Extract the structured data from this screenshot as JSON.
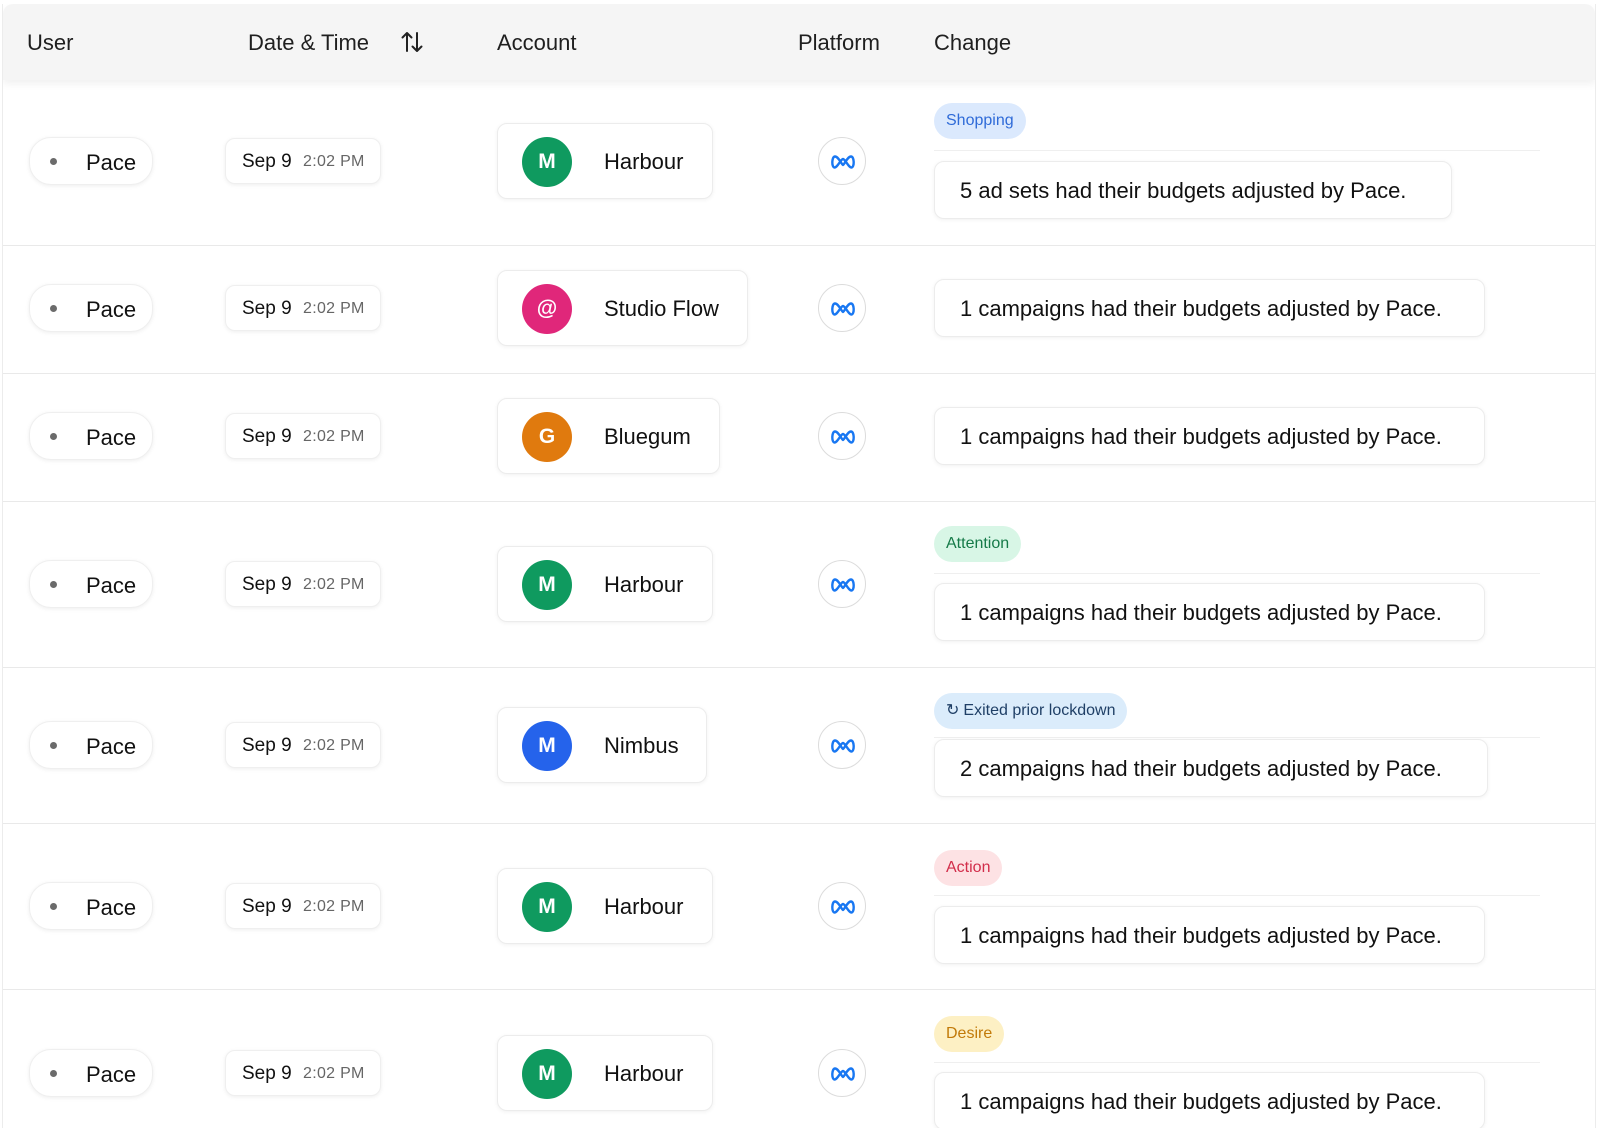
{
  "header": {
    "user": "User",
    "date_time": "Date & Time",
    "account": "Account",
    "platform": "Platform",
    "change": "Change",
    "sort_icon": "sort-arrows-icon"
  },
  "rows": [
    {
      "user": "Pace",
      "date": "Sep 9",
      "time": "2:02 PM",
      "account": {
        "initial": "M",
        "name": "Harbour",
        "color": "#0f9a5f"
      },
      "platform_icon": "meta-icon",
      "tag": {
        "label": "Shopping",
        "bg": "#dbe9fd",
        "fg": "#2f6bd8"
      },
      "change": "5 ad sets had their budgets adjusted by Pace."
    },
    {
      "user": "Pace",
      "date": "Sep 9",
      "time": "2:02 PM",
      "account": {
        "initial": "@",
        "name": "Studio Flow",
        "color": "#e0277a"
      },
      "platform_icon": "meta-icon",
      "tag": null,
      "change": "1 campaigns had their budgets adjusted by Pace."
    },
    {
      "user": "Pace",
      "date": "Sep 9",
      "time": "2:02 PM",
      "account": {
        "initial": "G",
        "name": "Bluegum",
        "color": "#e07a0e"
      },
      "platform_icon": "meta-icon",
      "tag": null,
      "change": "1 campaigns had their budgets adjusted by Pace."
    },
    {
      "user": "Pace",
      "date": "Sep 9",
      "time": "2:02 PM",
      "account": {
        "initial": "M",
        "name": "Harbour",
        "color": "#0f9a5f"
      },
      "platform_icon": "meta-icon",
      "tag": {
        "label": "Attention",
        "bg": "#d8f6e6",
        "fg": "#157a48"
      },
      "change": "1 campaigns had their budgets adjusted by Pace."
    },
    {
      "user": "Pace",
      "date": "Sep 9",
      "time": "2:02 PM",
      "account": {
        "initial": "M",
        "name": "Nimbus",
        "color": "#2563eb"
      },
      "platform_icon": "meta-icon",
      "tag": {
        "label": "Exited prior lockdown",
        "icon": "↻",
        "bg": "#dbecfb",
        "fg": "#1f3f66"
      },
      "change": "2 campaigns had their budgets adjusted by Pace."
    },
    {
      "user": "Pace",
      "date": "Sep 9",
      "time": "2:02 PM",
      "account": {
        "initial": "M",
        "name": "Harbour",
        "color": "#0f9a5f"
      },
      "platform_icon": "meta-icon",
      "tag": {
        "label": "Action",
        "bg": "#fde2e4",
        "fg": "#d22d4a"
      },
      "change": "1 campaigns had their budgets adjusted by Pace."
    },
    {
      "user": "Pace",
      "date": "Sep 9",
      "time": "2:02 PM",
      "account": {
        "initial": "M",
        "name": "Harbour",
        "color": "#0f9a5f"
      },
      "platform_icon": "meta-icon",
      "tag": {
        "label": "Desire",
        "bg": "#fdf0c4",
        "fg": "#c27a09"
      },
      "change": "1 campaigns had their budgets adjusted by Pace."
    }
  ]
}
